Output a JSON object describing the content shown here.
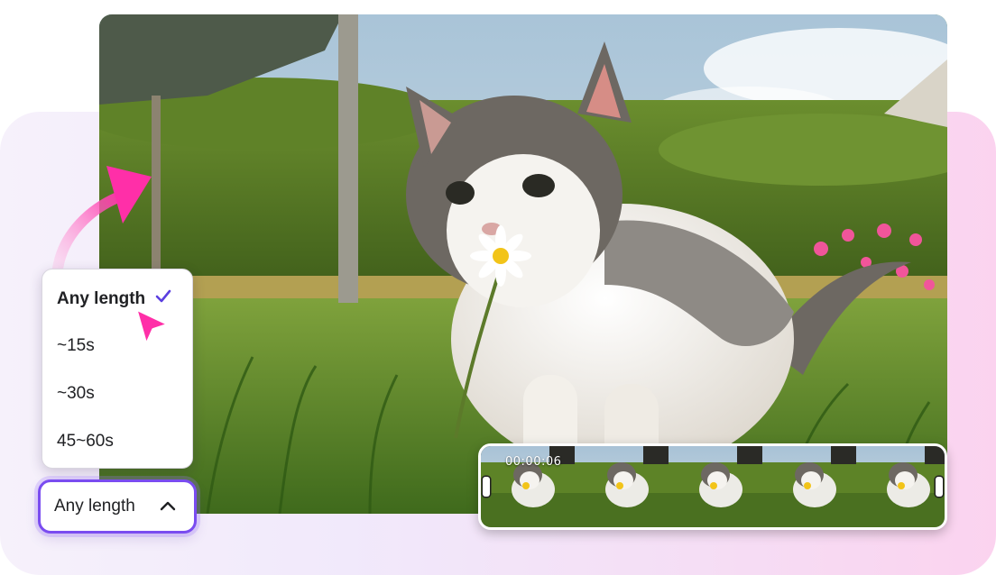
{
  "length_menu": {
    "options": [
      "Any length",
      "~15s",
      "~30s",
      "45~60s"
    ],
    "selected": "Any length"
  },
  "length_dropdown": {
    "label": "Any length",
    "expanded": true
  },
  "timeline": {
    "timecode": "00:00:06",
    "frame_count": 5
  },
  "icons": {
    "check": "check-icon",
    "chevron": "chevron-up-icon",
    "cursor": "cursor-pointer-icon",
    "arrow": "curved-arrow-icon"
  },
  "colors": {
    "accent": "#7a4cf0",
    "arrow": "#ff2fa8",
    "check": "#5b3fe0"
  }
}
